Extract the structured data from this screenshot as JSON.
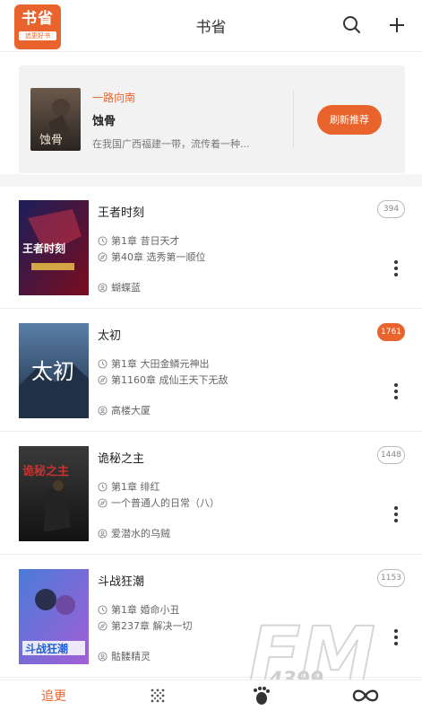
{
  "header": {
    "logo_big": "书省",
    "logo_small": "追更好书",
    "title": "书省",
    "search_icon": "search-icon",
    "add_icon": "plus-icon"
  },
  "recommend": {
    "tag": "一路向南",
    "book_title": "蚀骨",
    "cover_text": "蚀骨",
    "description": "在我国广西福建一带，流传着一种...",
    "button_label": "刷新推荐"
  },
  "books": [
    {
      "title": "王者时刻",
      "chapter_first": "第1章 昔日天才",
      "chapter_latest": "第40章 选秀第一顺位",
      "author": "蝴蝶蓝",
      "badge": "394",
      "hot": false,
      "cover_text": "王者时刻"
    },
    {
      "title": "太初",
      "chapter_first": "第1章 大田金鳞元神出",
      "chapter_latest": "第1160章 成仙王天下无敌",
      "author": "高楼大厦",
      "badge": "1761",
      "hot": true,
      "cover_text": "太初"
    },
    {
      "title": "诡秘之主",
      "chapter_first": "第1章 绯红",
      "chapter_latest": "一个普通人的日常（八）",
      "author": "爱潜水的乌贼",
      "badge": "1448",
      "hot": false,
      "cover_text": "诡秘之主"
    },
    {
      "title": "斗战狂潮",
      "chapter_first": "第1章 婚命小丑",
      "chapter_latest": "第237章 解决一切",
      "author": "骷髅精灵",
      "badge": "1153",
      "hot": false,
      "cover_text": "斗战狂潮"
    }
  ],
  "tabbar": {
    "tab_follow": "追更",
    "tab_discover_icon": "dots-grid-icon",
    "tab_explore_icon": "footprint-icon",
    "tab_more_icon": "infinity-icon"
  },
  "watermark": {
    "text_big": "FM",
    "text_small": "4399"
  },
  "colors": {
    "accent": "#e8642c",
    "background": "#ffffff",
    "separator": "#f5f5f5"
  }
}
